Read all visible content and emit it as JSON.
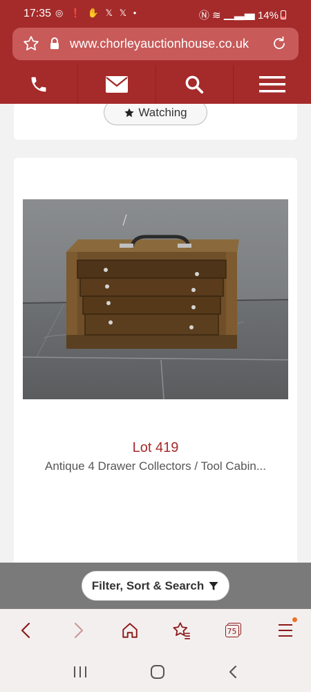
{
  "status_bar": {
    "time": "17:35",
    "notification_icons": "◎ ❗ ✋ 𝕏 𝕏 •",
    "battery": "14%"
  },
  "browser": {
    "url": "www.chorleyauctionhouse.co.uk"
  },
  "site_nav": {
    "items": [
      "phone-icon",
      "email-icon",
      "search-icon",
      "menu-icon"
    ]
  },
  "previous_lot": {
    "watch_label": "Watching"
  },
  "lot": {
    "number": "Lot 419",
    "title": "Antique 4 Drawer Collectors / Tool Cabin..."
  },
  "filter": {
    "label": "Filter, Sort & Search"
  },
  "browser_toolbar": {
    "tabs_count": "75",
    "items": [
      "back-icon",
      "forward-icon",
      "home-icon",
      "bookmarks-icon",
      "tabs-icon",
      "menu-icon"
    ]
  },
  "android_nav": {
    "items": [
      "recents-icon",
      "home-icon",
      "back-icon"
    ]
  },
  "colors": {
    "brand": "#a52a2a",
    "accent_dot": "#e8742a"
  }
}
